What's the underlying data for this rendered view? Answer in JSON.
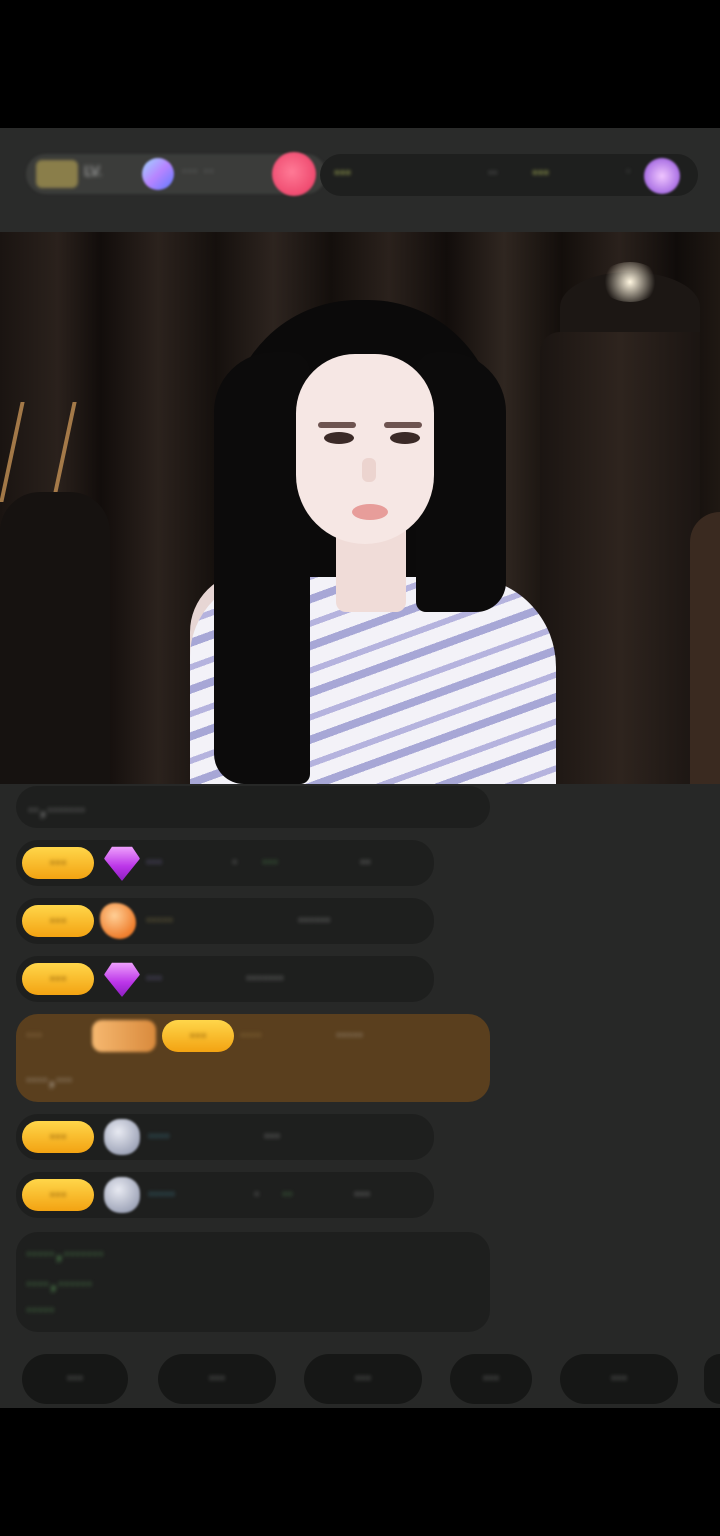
{
  "header": {
    "level_badge": "Lv",
    "level_text": "LV.",
    "viewers_text": "··· ··",
    "rank_text_1": "···",
    "rank_text_2": "··",
    "rank_text_3": "···",
    "rank_sep": "·"
  },
  "chat": {
    "welcome_text": "··，·······",
    "messages": [
      {
        "badge": "···",
        "name": "···",
        "mid": "·",
        "target": "···",
        "content": "··"
      },
      {
        "badge": "···",
        "name": "·····",
        "content": "······"
      },
      {
        "badge": "···",
        "name": "···",
        "content": "·······"
      },
      {
        "badge": "···",
        "name": "····",
        "content": "···"
      },
      {
        "badge": "···",
        "name": "·····",
        "mid": "·",
        "target": "··",
        "content": "···"
      }
    ],
    "gift": {
      "prefix": "···",
      "badge": "···",
      "name": "····",
      "content_1": "·····",
      "content_2": "····，···"
    },
    "system_line_1": "·····，·······",
    "system_line_2": "····，······",
    "system_line_3": "·····"
  },
  "quick_replies": [
    "···",
    "···",
    "···",
    "···",
    "···"
  ],
  "colors": {
    "accent_yellow": "#f3b320",
    "follow_pink": "#e8365f",
    "gift_brown": "#5a3f1e",
    "system_green": "#6fc96d"
  }
}
